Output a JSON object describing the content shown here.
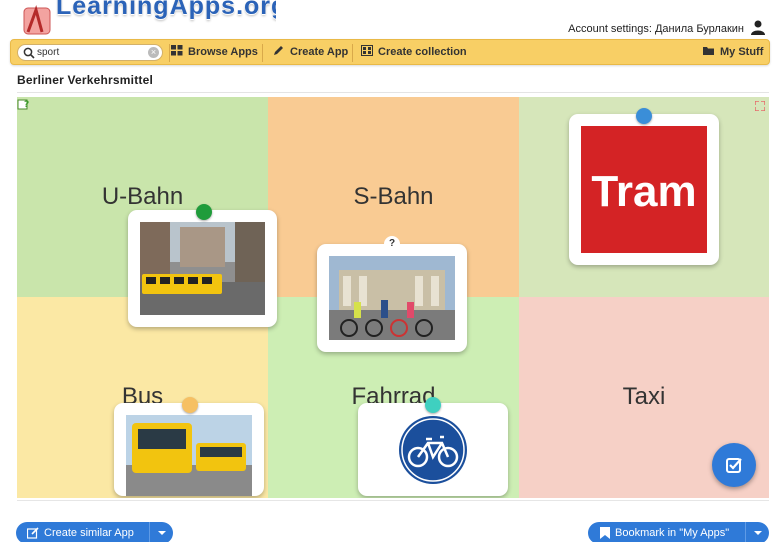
{
  "header": {
    "logo_text": "LearningApps.org",
    "account_text": "Account settings: Данила Бурлакин"
  },
  "toolbar": {
    "search_value": "sport",
    "items": [
      {
        "label": "Browse Apps",
        "icon": "grid-icon"
      },
      {
        "label": "Create App",
        "icon": "pencil-icon"
      },
      {
        "label": "Create collection",
        "icon": "collection-icon"
      },
      {
        "label": "My Stuff",
        "icon": "folder-icon"
      }
    ]
  },
  "app": {
    "title": "Berliner Verkehrsmittel"
  },
  "board": {
    "categories": [
      {
        "label": "U-Bahn",
        "color": "#c9e5ab"
      },
      {
        "label": "S-Bahn",
        "color": "#f9cb93"
      },
      {
        "label": "Tram",
        "color": "#d6e6ba"
      },
      {
        "label": "Bus",
        "color": "#fbe8a4"
      },
      {
        "label": "Fahrrad",
        "color": "#cdeeb4"
      },
      {
        "label": "Taxi",
        "color": "#f6d0c6"
      }
    ],
    "cards": [
      {
        "name": "card-tram-photo",
        "pin_color": "#1f9c3b"
      },
      {
        "name": "card-bicycle-group-photo",
        "question": "?"
      },
      {
        "name": "card-tram-sign",
        "pin_color": "#3a8ed8",
        "sign_text": "Tram"
      },
      {
        "name": "card-bus-photo",
        "pin_color": "#f6c063"
      },
      {
        "name": "card-bicycle-sign",
        "pin_color": "#3fd0c0"
      }
    ]
  },
  "actions": {
    "create_similar": "Create similar App",
    "bookmark": "Bookmark in \"My Apps\""
  },
  "colors": {
    "toolbar_bg": "#f8cf65",
    "accent_blue": "#2f7ad8",
    "sign_red": "#d42325"
  }
}
